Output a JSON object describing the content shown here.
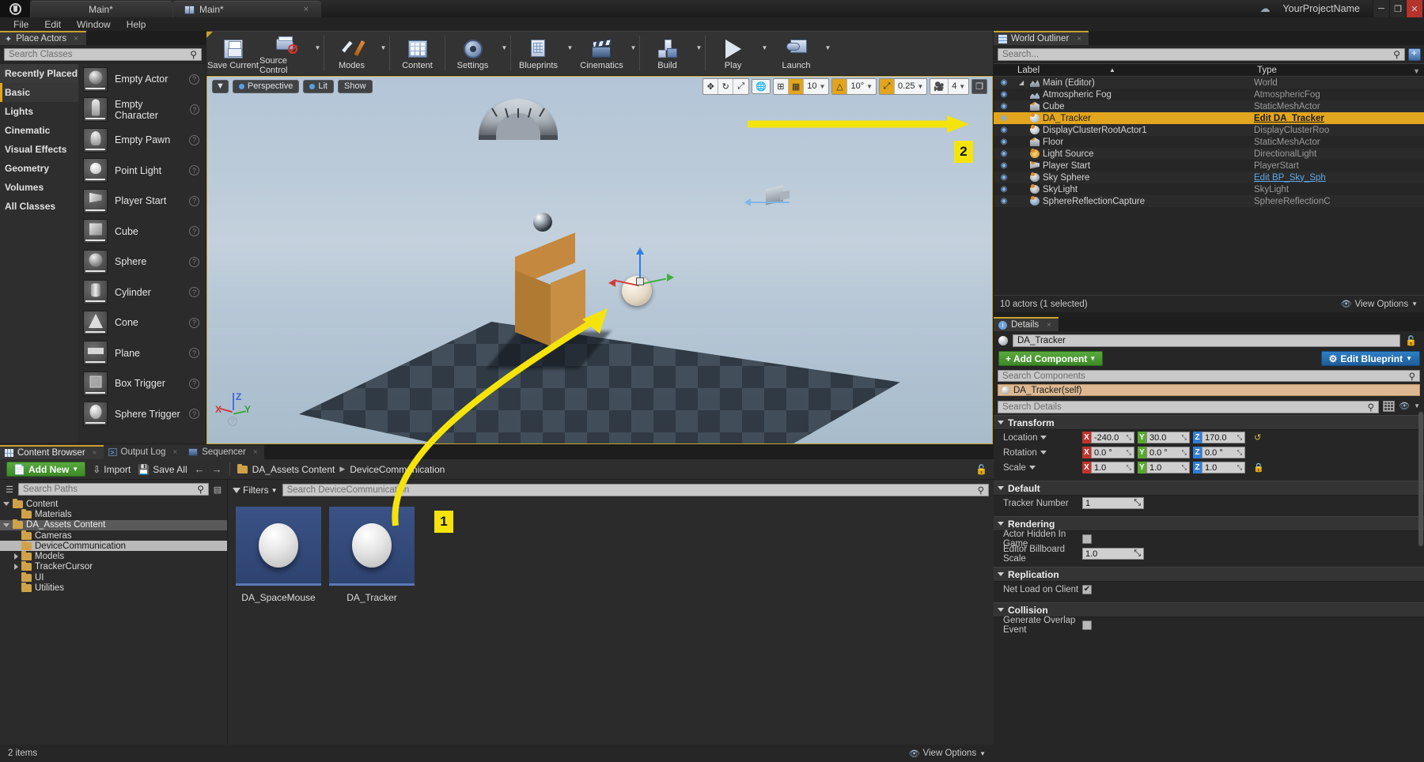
{
  "titlebar": {
    "tab1": "Main*",
    "tab2": "Main*",
    "project": "YourProjectName",
    "close_glyph": "✕",
    "min_glyph": "─",
    "max_glyph": "❐",
    "x_glyph": "×",
    "cloud_icon": "cloud-icon"
  },
  "menu": [
    "File",
    "Edit",
    "Window",
    "Help"
  ],
  "place_actors": {
    "tab": "Place Actors",
    "search_placeholder": "Search Classes",
    "categories": [
      {
        "label": "Recently Placed",
        "selected": false,
        "hover": true
      },
      {
        "label": "Basic",
        "selected": true,
        "hover": false
      },
      {
        "label": "Lights",
        "selected": false,
        "hover": false
      },
      {
        "label": "Cinematic",
        "selected": false,
        "hover": false
      },
      {
        "label": "Visual Effects",
        "selected": false,
        "hover": false
      },
      {
        "label": "Geometry",
        "selected": false,
        "hover": false
      },
      {
        "label": "Volumes",
        "selected": false,
        "hover": false
      },
      {
        "label": "All Classes",
        "selected": false,
        "hover": false
      }
    ],
    "items": [
      {
        "label": "Empty Actor",
        "shape": "sphere"
      },
      {
        "label": "Empty Character",
        "shape": "char"
      },
      {
        "label": "Empty Pawn",
        "shape": "pawn"
      },
      {
        "label": "Point Light",
        "shape": "bulb"
      },
      {
        "label": "Player Start",
        "shape": "flag"
      },
      {
        "label": "Cube",
        "shape": "cube"
      },
      {
        "label": "Sphere",
        "shape": "sphere"
      },
      {
        "label": "Cylinder",
        "shape": "cyl"
      },
      {
        "label": "Cone",
        "shape": "cone"
      },
      {
        "label": "Plane",
        "shape": "plane"
      },
      {
        "label": "Box Trigger",
        "shape": "boxtrig"
      },
      {
        "label": "Sphere Trigger",
        "shape": "sphtrig"
      }
    ],
    "help_glyph": "?"
  },
  "toolbar": {
    "buttons": [
      {
        "label": "Save Current",
        "icon": "save-icon",
        "dropdown": false
      },
      {
        "label": "Source Control",
        "icon": "source-control-icon",
        "dropdown": true
      },
      {
        "label": "Modes",
        "icon": "modes-icon",
        "dropdown": true
      },
      {
        "label": "Content",
        "icon": "content-icon",
        "dropdown": false
      },
      {
        "label": "Settings",
        "icon": "settings-icon",
        "dropdown": true
      },
      {
        "label": "Blueprints",
        "icon": "blueprints-icon",
        "dropdown": true
      },
      {
        "label": "Cinematics",
        "icon": "cinematics-icon",
        "dropdown": true
      },
      {
        "label": "Build",
        "icon": "build-icon",
        "dropdown": true
      },
      {
        "label": "Play",
        "icon": "play-icon",
        "dropdown": true
      },
      {
        "label": "Launch",
        "icon": "launch-icon",
        "dropdown": true
      }
    ]
  },
  "viewport": {
    "perspective": "Perspective",
    "lit": "Lit",
    "show": "Show",
    "grid_snap_value": "10",
    "angle_snap_value": "10°",
    "scale_snap_value": "0.25",
    "camera_speed_value": "4",
    "axes": {
      "x": "X",
      "y": "Y",
      "z": "Z",
      "help": "?"
    }
  },
  "annotations": [
    {
      "id": "1",
      "label": "1"
    },
    {
      "id": "2",
      "label": "2"
    }
  ],
  "outliner": {
    "tab": "World Outliner",
    "search_placeholder": "Search...",
    "columns": {
      "label": "Label",
      "type": "Type"
    },
    "rows": [
      {
        "label": "Main (Editor)",
        "type": "World",
        "icon": "world-icon",
        "indent": 0,
        "expandable": true,
        "selected": false,
        "link": false
      },
      {
        "label": "Atmospheric Fog",
        "type": "AtmosphericFog",
        "icon": "fog-icon",
        "indent": 1,
        "expandable": false,
        "selected": false,
        "link": false
      },
      {
        "label": "Cube",
        "type": "StaticMeshActor",
        "icon": "mesh-icon",
        "indent": 1,
        "expandable": false,
        "selected": false,
        "link": false
      },
      {
        "label": "DA_Tracker",
        "type": "Edit DA_Tracker",
        "icon": "ball-icon",
        "indent": 1,
        "expandable": false,
        "selected": true,
        "link": false
      },
      {
        "label": "DisplayClusterRootActor1",
        "type": "DisplayClusterRoo",
        "icon": "ball-icon",
        "indent": 1,
        "expandable": false,
        "selected": false,
        "link": false
      },
      {
        "label": "Floor",
        "type": "StaticMeshActor",
        "icon": "mesh-icon",
        "indent": 1,
        "expandable": false,
        "selected": false,
        "link": false
      },
      {
        "label": "Light Source",
        "type": "DirectionalLight",
        "icon": "light-icon",
        "indent": 1,
        "expandable": false,
        "selected": false,
        "link": false
      },
      {
        "label": "Player Start",
        "type": "PlayerStart",
        "icon": "player-icon",
        "indent": 1,
        "expandable": false,
        "selected": false,
        "link": false
      },
      {
        "label": "Sky Sphere",
        "type": "Edit BP_Sky_Sph",
        "icon": "skylight-icon",
        "indent": 1,
        "expandable": false,
        "selected": false,
        "link": true
      },
      {
        "label": "SkyLight",
        "type": "SkyLight",
        "icon": "skylight-icon",
        "indent": 1,
        "expandable": false,
        "selected": false,
        "link": false
      },
      {
        "label": "SphereReflectionCapture",
        "type": "SphereReflectionC",
        "icon": "reflection-icon",
        "indent": 1,
        "expandable": false,
        "selected": false,
        "link": false
      }
    ],
    "status": "10 actors (1 selected)",
    "view_options": "View Options"
  },
  "details": {
    "tab": "Details",
    "actor_name": "DA_Tracker",
    "add_component": "Add Component",
    "edit_blueprint": "Edit Blueprint",
    "search_components_placeholder": "Search Components",
    "component_row": "DA_Tracker(self)",
    "search_details_placeholder": "Search Details",
    "sections": [
      {
        "title": "Transform",
        "rows": [
          {
            "label": "Location",
            "type": "vector",
            "has_dropdown": true,
            "values": [
              {
                "axis": "X",
                "value": "-240.0"
              },
              {
                "axis": "Y",
                "value": "30.0"
              },
              {
                "axis": "Z",
                "value": "170.0"
              }
            ],
            "trailing": "reset"
          },
          {
            "label": "Rotation",
            "type": "vector",
            "has_dropdown": true,
            "values": [
              {
                "axis": "X",
                "value": "0.0 °"
              },
              {
                "axis": "Y",
                "value": "0.0 °"
              },
              {
                "axis": "Z",
                "value": "0.0 °"
              }
            ],
            "trailing": ""
          },
          {
            "label": "Scale",
            "type": "vector",
            "has_dropdown": true,
            "values": [
              {
                "axis": "X",
                "value": "1.0"
              },
              {
                "axis": "Y",
                "value": "1.0"
              },
              {
                "axis": "Z",
                "value": "1.0"
              }
            ],
            "trailing": "lock"
          }
        ]
      },
      {
        "title": "Default",
        "rows": [
          {
            "label": "Tracker Number",
            "type": "number",
            "has_dropdown": false,
            "value": "1",
            "trailing": ""
          }
        ]
      },
      {
        "title": "Rendering",
        "rows": [
          {
            "label": "Actor Hidden In Game",
            "type": "checkbox",
            "has_dropdown": false,
            "checked": false,
            "trailing": ""
          },
          {
            "label": "Editor Billboard Scale",
            "type": "number",
            "has_dropdown": false,
            "value": "1.0",
            "trailing": ""
          }
        ]
      },
      {
        "title": "Replication",
        "rows": [
          {
            "label": "Net Load on Client",
            "type": "checkbox",
            "has_dropdown": false,
            "checked": true,
            "trailing": ""
          }
        ]
      },
      {
        "title": "Collision",
        "rows": [
          {
            "label": "Generate Overlap Event",
            "type": "checkbox",
            "has_dropdown": false,
            "checked": false,
            "trailing": ""
          }
        ]
      }
    ]
  },
  "content_browser": {
    "tabs": [
      {
        "label": "Content Browser",
        "active": true,
        "icon": "content-browser-icon"
      },
      {
        "label": "Output Log",
        "active": false,
        "icon": "output-log-icon"
      },
      {
        "label": "Sequencer",
        "active": false,
        "icon": "sequencer-icon"
      }
    ],
    "add_new": "Add New",
    "import": "Import",
    "save_all": "Save All",
    "back_glyph": "←",
    "forward_glyph": "→",
    "breadcrumb": [
      "DA_Assets Content",
      "DeviceCommunication"
    ],
    "search_paths_placeholder": "Search Paths",
    "tree": [
      {
        "label": "Content",
        "depth": 0,
        "state": "open",
        "selected": false,
        "hl": false
      },
      {
        "label": "Materials",
        "depth": 1,
        "state": "leaf",
        "selected": false,
        "hl": false
      },
      {
        "label": "DA_Assets Content",
        "depth": 0,
        "state": "open",
        "selected": false,
        "hl": true
      },
      {
        "label": "Cameras",
        "depth": 1,
        "state": "leaf",
        "selected": false,
        "hl": false
      },
      {
        "label": "DeviceCommunication",
        "depth": 1,
        "state": "leaf",
        "selected": true,
        "hl": false
      },
      {
        "label": "Models",
        "depth": 1,
        "state": "closed",
        "selected": false,
        "hl": false
      },
      {
        "label": "TrackerCursor",
        "depth": 1,
        "state": "closed",
        "selected": false,
        "hl": false
      },
      {
        "label": "UI",
        "depth": 1,
        "state": "leaf",
        "selected": false,
        "hl": false
      },
      {
        "label": "Utilities",
        "depth": 1,
        "state": "leaf",
        "selected": false,
        "hl": false
      }
    ],
    "filters": "Filters",
    "search_assets_placeholder": "Search DeviceCommunication",
    "assets": [
      {
        "name": "DA_SpaceMouse"
      },
      {
        "name": "DA_Tracker"
      }
    ],
    "item_count": "2 items",
    "view_options": "View Options"
  }
}
